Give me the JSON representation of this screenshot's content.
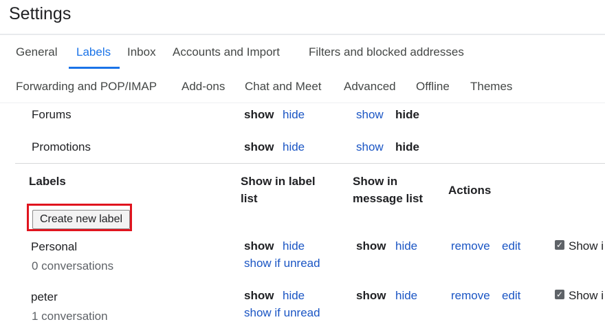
{
  "page": {
    "title": "Settings"
  },
  "tabs_row1": [
    "General",
    "Labels",
    "Inbox",
    "Accounts and Import",
    "Filters and blocked addresses"
  ],
  "tabs_row2": [
    "Forwarding and POP/IMAP",
    "Add-ons",
    "Chat and Meet",
    "Advanced",
    "Offline",
    "Themes"
  ],
  "active_tab": "Labels",
  "categories": [
    {
      "name": "Forums",
      "show": "show",
      "hide": "hide",
      "msg_show": "show",
      "msg_hide": "hide"
    },
    {
      "name": "Promotions",
      "show": "show",
      "hide": "hide",
      "msg_show": "show",
      "msg_hide": "hide"
    }
  ],
  "labels_header": {
    "labels": "Labels",
    "show_in_label_list": "Show in label list",
    "show_in_message_list": "Show in message list",
    "actions": "Actions"
  },
  "create_button": "Create new label",
  "labels": [
    {
      "name": "Personal",
      "count": "0 conversations",
      "show": "show",
      "hide": "hide",
      "show_if_unread": "show if unread",
      "msg_show": "show",
      "msg_hide": "hide",
      "remove": "remove",
      "edit": "edit",
      "checkbox_label": "Show i",
      "checked": true
    },
    {
      "name": "peter",
      "count": "1 conversation",
      "show": "show",
      "hide": "hide",
      "show_if_unread": "show if unread",
      "msg_show": "show",
      "msg_hide": "hide",
      "remove": "remove",
      "edit": "edit",
      "checkbox_label": "Show i",
      "checked": true
    }
  ],
  "colors": {
    "accent": "#1a73e8",
    "link": "#1a55c4",
    "highlight": "#e0141e"
  }
}
